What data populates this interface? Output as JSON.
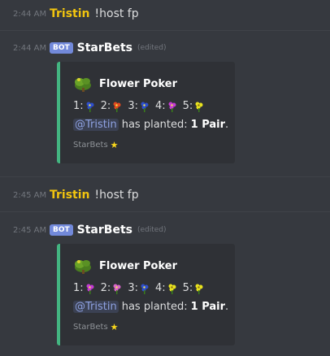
{
  "messages": [
    {
      "time": "2:44 AM",
      "user": "Tristin",
      "text": "!host fp"
    },
    {
      "time": "2:45 AM",
      "user": "Tristin",
      "text": "!host fp"
    }
  ],
  "bot_posts": [
    {
      "time": "2:44 AM",
      "badge": "BOT",
      "name": "StarBets",
      "edited": "(edited)",
      "embed": {
        "title": "Flower Poker",
        "flower_icon": "bush-icon",
        "flowers": [
          {
            "num": "1:",
            "color": "#2e4fcf",
            "icon": "flower-blue-icon"
          },
          {
            "num": "2:",
            "color": "#e24a1f",
            "icon": "flower-red-icon"
          },
          {
            "num": "3:",
            "color": "#2e4fcf",
            "icon": "flower-blue-icon"
          },
          {
            "num": "4:",
            "color": "#c43bd4",
            "icon": "flower-purple-icon"
          },
          {
            "num": "5:",
            "color": "#e8e21e",
            "icon": "flower-yellow-icon"
          }
        ],
        "mention": "@Tristin",
        "planted": "has planted:",
        "hand": "1 Pair",
        "period": ".",
        "footer": "StarBets",
        "footer_icon": "star-icon"
      }
    },
    {
      "time": "2:45 AM",
      "badge": "BOT",
      "name": "StarBets",
      "edited": "(edited)",
      "embed": {
        "title": "Flower Poker",
        "flower_icon": "bush-icon",
        "flowers": [
          {
            "num": "1:",
            "color": "#c43bd4",
            "icon": "flower-purple-icon"
          },
          {
            "num": "2:",
            "color": "#d966c9",
            "icon": "flower-pink-icon"
          },
          {
            "num": "3:",
            "color": "#2e4fcf",
            "icon": "flower-blue-icon"
          },
          {
            "num": "4:",
            "color": "#e8e21e",
            "icon": "flower-yellow-icon"
          },
          {
            "num": "5:",
            "color": "#e8e21e",
            "icon": "flower-yellow-icon"
          }
        ],
        "mention": "@Tristin",
        "planted": "has planted:",
        "hand": "1 Pair",
        "period": ".",
        "footer": "StarBets",
        "footer_icon": "star-icon"
      }
    }
  ],
  "colors": {
    "background": "#36393f",
    "embed_bg": "#2f3136",
    "embed_accent": "#43b581",
    "username": "#f1c40f",
    "bot_badge": "#7289da",
    "mention": "#8ea1e1"
  }
}
